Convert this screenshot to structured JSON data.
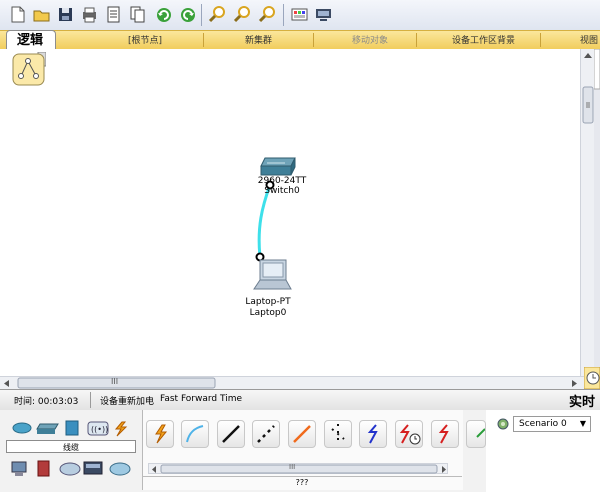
{
  "toolbar": {
    "icons": [
      "new-file-icon",
      "open-folder-icon",
      "save-icon",
      "print-icon",
      "activity-wizard-icon",
      "copy-icon",
      "undo-icon",
      "redo-icon",
      "zoom-in-icon",
      "zoom-reset-icon",
      "zoom-out-icon",
      "palette-icon",
      "custom-device-icon"
    ]
  },
  "logic_bar": {
    "tab_label": "逻辑",
    "items": [
      "[根节点]",
      "新集群",
      "移动对象",
      "设备工作区背景",
      "视图"
    ]
  },
  "canvas": {
    "devices": [
      {
        "model": "2960-24TT",
        "name": "Switch0"
      },
      {
        "model": "Laptop-PT",
        "name": "Laptop0"
      }
    ]
  },
  "scroll": {
    "grip": "III"
  },
  "status_bar": {
    "time": "时间: 00:03:03",
    "power_cycle": "设备重新加电",
    "fast_forward": "Fast Forward Time",
    "mode": "实时"
  },
  "device_panel": {
    "category_label": "线缆"
  },
  "connections_panel": {
    "description": "???"
  },
  "scenario": {
    "selected": "Scenario 0"
  },
  "colors": {
    "link": "#3ee0ea",
    "logic_bar": "#f1cd5d"
  }
}
